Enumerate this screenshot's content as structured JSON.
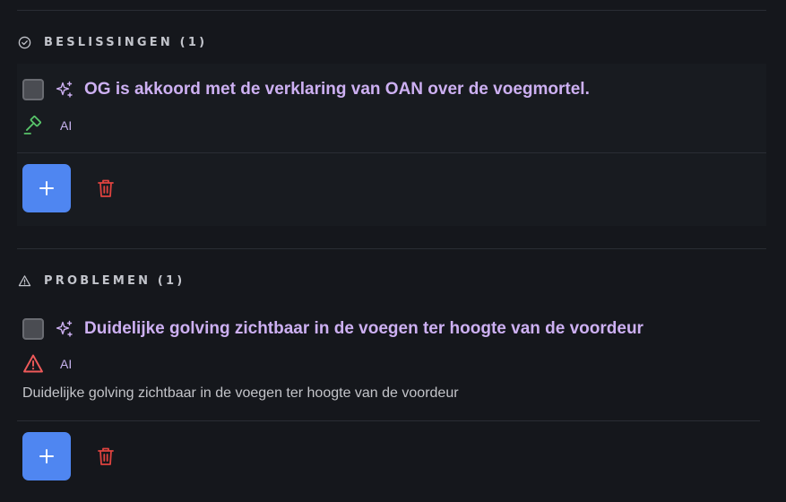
{
  "decisions": {
    "title": "BESLISSINGEN (1)",
    "icon": "check-circle-icon",
    "items": [
      {
        "title": "OG is akkoord met de verklaring van OAN over de voegmortel.",
        "type_icon": "gavel-icon",
        "source": "AI",
        "checked": false
      }
    ],
    "add_icon": "plus-icon",
    "delete_icon": "trash-icon"
  },
  "problems": {
    "title": "PROBLEMEN (1)",
    "icon": "warning-triangle-icon",
    "items": [
      {
        "title": "Duidelijke golving zichtbaar in de voegen ter hoogte van de voordeur",
        "type_icon": "warning-triangle-icon",
        "source": "AI",
        "description": "Duidelijke golving zichtbaar in de voegen ter hoogte van de voordeur",
        "checked": false
      }
    ],
    "add_icon": "plus-icon",
    "delete_icon": "trash-icon"
  },
  "colors": {
    "background": "#15171c",
    "card": "#181b20",
    "accent_purple": "#cdb0f2",
    "add_button": "#4f86f1",
    "delete": "#e0433f",
    "gavel": "#58c46a",
    "warning": "#ef5a5a"
  }
}
